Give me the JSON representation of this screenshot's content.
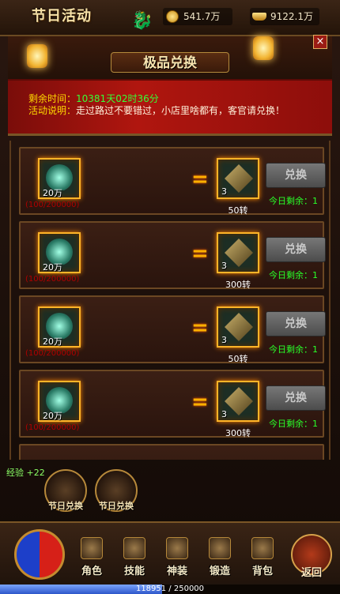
{
  "header": {
    "event_title": "节日活动",
    "gold": "541.7万",
    "ingot": "9122.1万",
    "panel_title": "极品兑换",
    "close_symbol": "×"
  },
  "info": {
    "time_label": "剩余时间：",
    "time_value": "10381天02时36分",
    "desc_label": "活动说明：",
    "desc_value": "走过路过不要错过，小店里啥都有，客官请兑换！"
  },
  "exchange": {
    "rows": [
      {
        "cost_qty": "20万",
        "progress": "(100/200000)",
        "reward_qty": "3",
        "reward_level": "50转",
        "button": "兑换",
        "remain": "今日剩余：1"
      },
      {
        "cost_qty": "20万",
        "progress": "(100/200000)",
        "reward_qty": "3",
        "reward_level": "300转",
        "button": "兑换",
        "remain": "今日剩余：1"
      },
      {
        "cost_qty": "20万",
        "progress": "(100/200000)",
        "reward_qty": "3",
        "reward_level": "50转",
        "button": "兑换",
        "remain": "今日剩余：1"
      },
      {
        "cost_qty": "20万",
        "progress": "(100/200000)",
        "reward_qty": "3",
        "reward_level": "300转",
        "button": "兑换",
        "remain": "今日剩余：1"
      }
    ],
    "equals": "="
  },
  "exp_note": "经验 +22",
  "festival_buttons": [
    "节日兑换",
    "节日兑换"
  ],
  "nav": {
    "items": [
      "角色",
      "技能",
      "神装",
      "锻造",
      "背包"
    ],
    "back": "返回"
  },
  "exp_bar": {
    "text": "118951 / 250000",
    "fraction": 0.4758
  },
  "colors": {
    "accent_gold": "#ffb428",
    "remain_green": "#29ff29",
    "time_green": "#36ff36",
    "progress_red": "#b00000"
  }
}
